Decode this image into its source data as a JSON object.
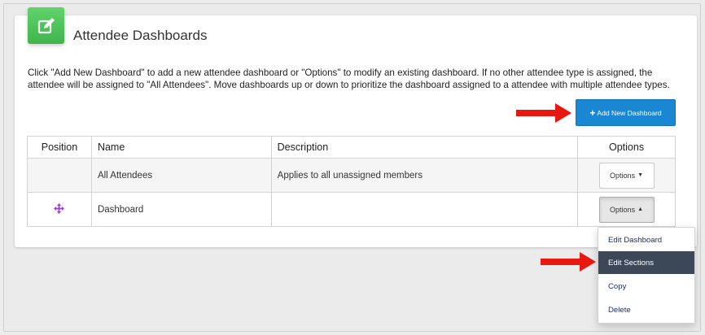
{
  "header": {
    "title": "Attendee Dashboards",
    "icon": "edit-icon",
    "icon_color": "#4cc25a"
  },
  "intro_text": "Click \"Add New Dashboard\" to add a new attendee dashboard or \"Options\" to modify an existing dashboard. If no other attendee type is assigned, the attendee will be assigned to \"All Attendees\". Move dashboards up or down to prioritize the dashboard assigned to a attendee with multiple attendee types.",
  "toolbar": {
    "add_label": "Add New Dashboard",
    "add_icon": "plus-icon",
    "add_color": "#1a87d2"
  },
  "table": {
    "columns": [
      "Position",
      "Name",
      "Description",
      "Options"
    ],
    "rows": [
      {
        "position": "",
        "name": "All Attendees",
        "description": "Applies to all unassigned members",
        "options_label": "Options"
      },
      {
        "position": "move-icon",
        "name": "Dashboard",
        "description": "",
        "options_label": "Options"
      }
    ]
  },
  "dropdown": {
    "items": [
      {
        "label": "Edit Dashboard"
      },
      {
        "label": "Edit Sections",
        "active": true
      },
      {
        "label": "Copy"
      },
      {
        "label": "Delete"
      }
    ],
    "active_color": "#3c4757"
  },
  "annotations": {
    "arrow_color": "#e8170f",
    "arrows": [
      "pointing-to-add-new-dashboard",
      "pointing-to-edit-sections"
    ]
  }
}
